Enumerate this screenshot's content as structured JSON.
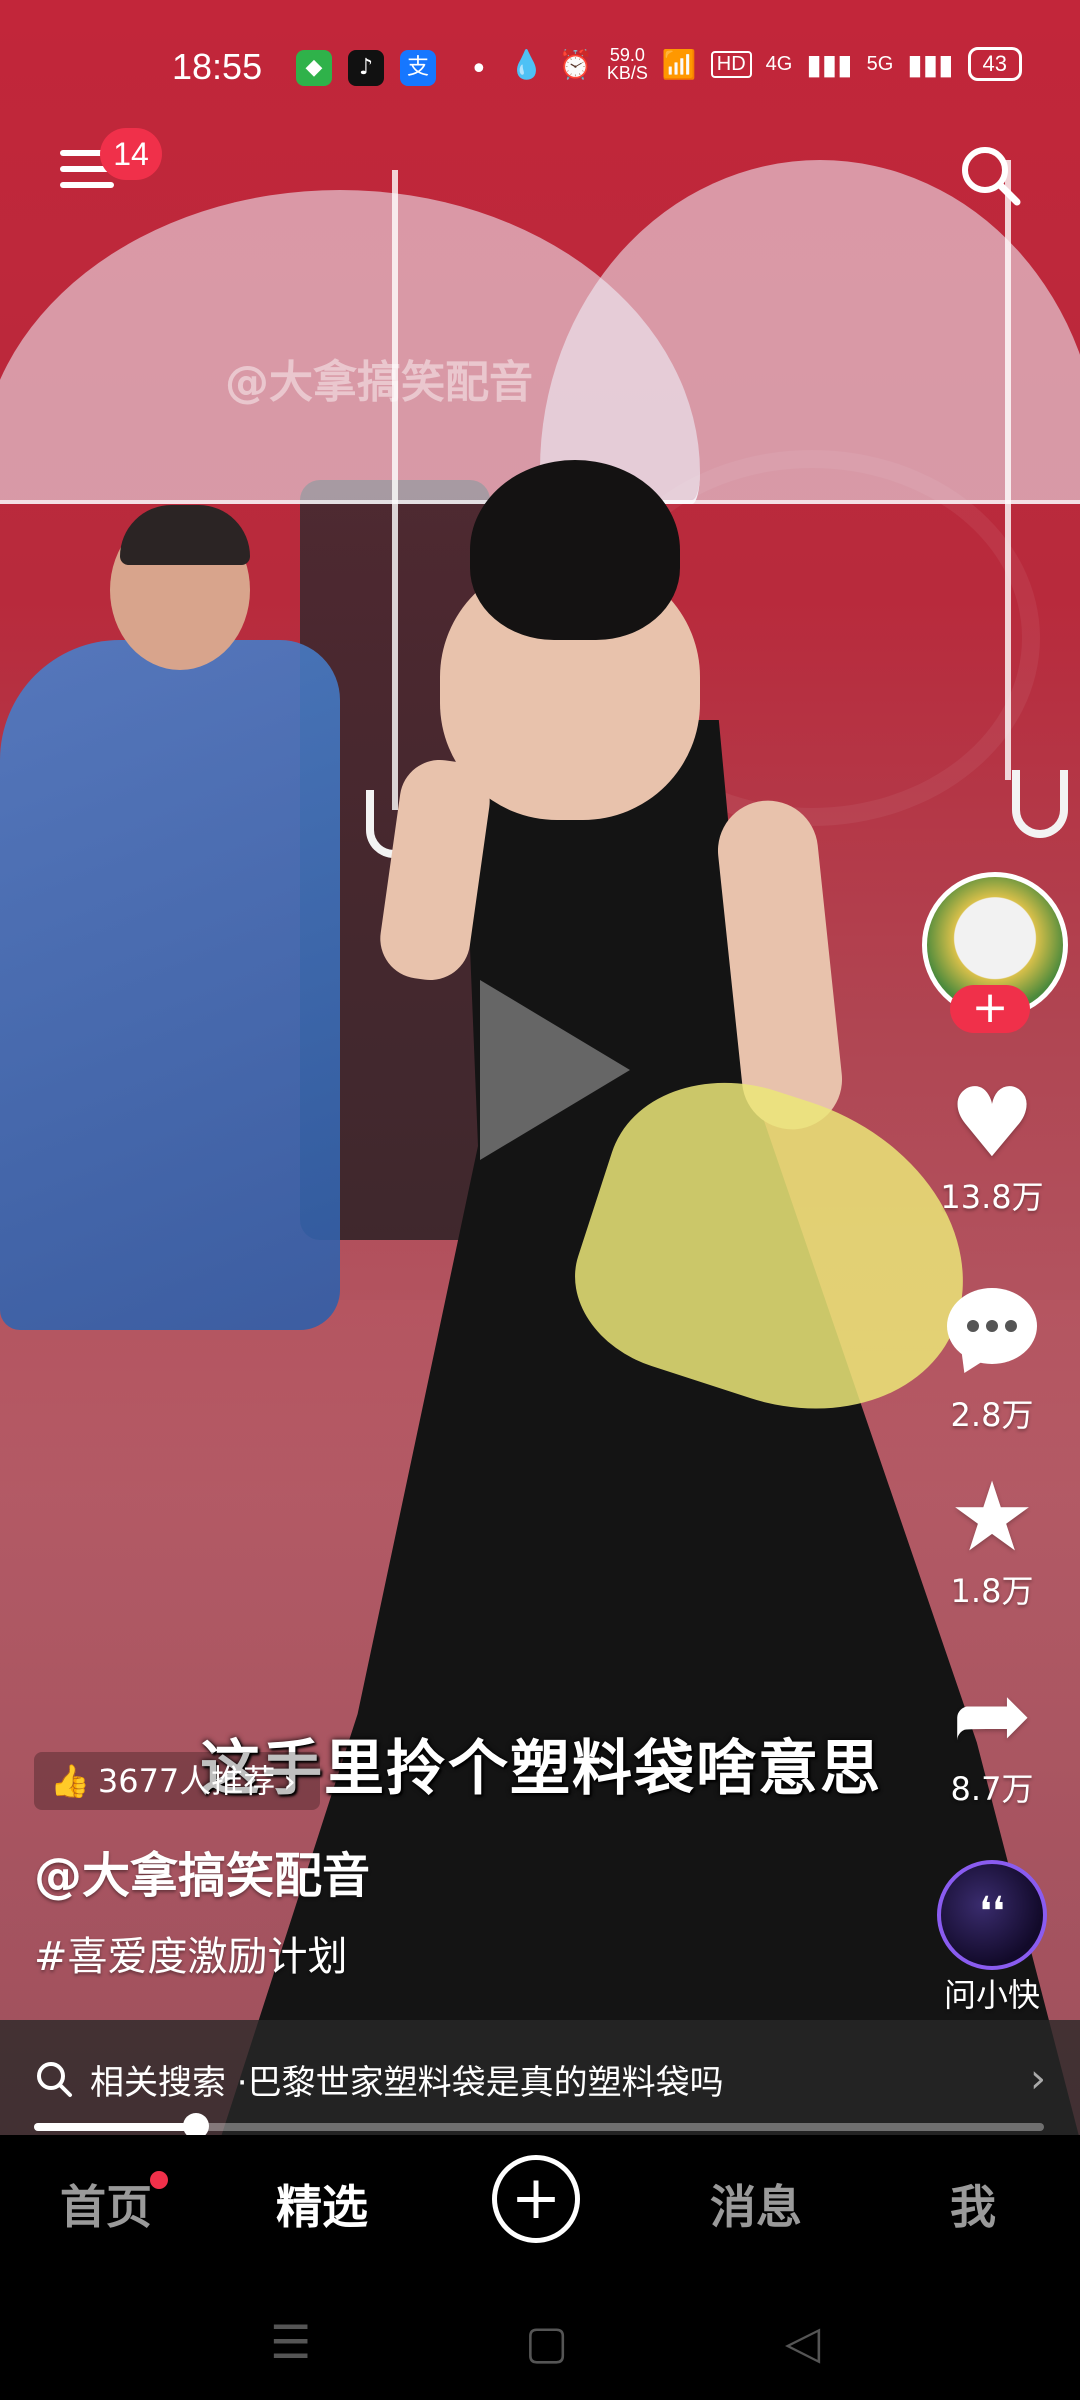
{
  "status_bar": {
    "time": "18:55",
    "net_speed": "59.0",
    "net_unit": "KB/S",
    "hd": "HD",
    "sig1": "4G",
    "sig2": "5G",
    "battery": "43"
  },
  "top": {
    "menu_badge": "14"
  },
  "watermark": "@大拿搞笑配音",
  "subtitle": "这手里拎个塑料袋啥意思",
  "rail": {
    "likes": "13.8万",
    "comments": "2.8万",
    "favorites": "1.8万",
    "shares": "8.7万",
    "ai_label": "问小快"
  },
  "recommend": "3677人推荐",
  "author": "@大拿搞笑配音",
  "hashtag": "#喜爱度激励计划",
  "related": {
    "prefix": "相关搜索 · ",
    "query": "巴黎世家塑料袋是真的塑料袋吗"
  },
  "progress": 0.16,
  "nav": {
    "home": "首页",
    "featured": "精选",
    "messages": "消息",
    "me": "我"
  },
  "icons": [
    "menu-icon",
    "search-icon",
    "heart-icon",
    "comment-icon",
    "star-icon",
    "share-icon",
    "thumbs-up-icon",
    "plus-icon",
    "chevron-right-icon"
  ],
  "colors": {
    "accent": "#f0304a"
  }
}
